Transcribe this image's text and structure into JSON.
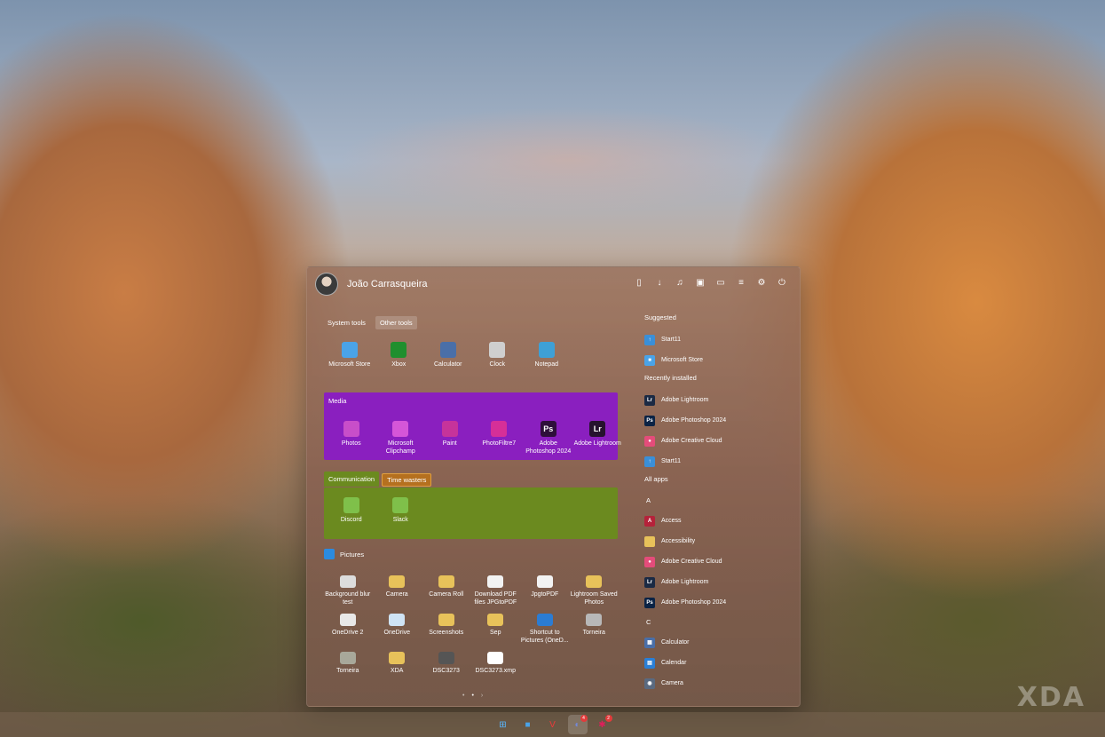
{
  "user": {
    "name": "João Carrasqueira"
  },
  "top_icons": [
    "document-icon",
    "download-icon",
    "music-icon",
    "image-icon",
    "folder-icon",
    "sliders-icon",
    "gear-icon",
    "power-icon"
  ],
  "tabs1": [
    {
      "label": "System tools",
      "active": false
    },
    {
      "label": "Other tools",
      "active": true
    }
  ],
  "system_apps": [
    {
      "label": "Microsoft Store",
      "icon": "store-icon",
      "color": "#4aa3e8"
    },
    {
      "label": "Xbox",
      "icon": "xbox-icon",
      "color": "#1f8f2e"
    },
    {
      "label": "Calculator",
      "icon": "calculator-icon",
      "color": "#4a6fa8"
    },
    {
      "label": "Clock",
      "icon": "clock-icon",
      "color": "#cfcfcf"
    },
    {
      "label": "Notepad",
      "icon": "notepad-icon",
      "color": "#3ea0d6"
    }
  ],
  "media": {
    "title": "Media",
    "color": "#8a1fbf",
    "apps": [
      {
        "label": "Photos",
        "icon": "photos-icon",
        "color": "#c84ec9"
      },
      {
        "label": "Microsoft Clipchamp",
        "icon": "clipchamp-icon",
        "color": "#d556d8"
      },
      {
        "label": "Paint",
        "icon": "paint-icon",
        "color": "#c6339b"
      },
      {
        "label": "PhotoFiltre7",
        "icon": "photofiltre-icon",
        "color": "#d62f98"
      },
      {
        "label": "Adobe Photoshop 2024",
        "icon": "photoshop-icon",
        "color": "#2f0f3a",
        "glyph": "Ps"
      },
      {
        "label": "Adobe Lightroom",
        "icon": "lightroom-icon",
        "color": "#26122e",
        "glyph": "Lr"
      }
    ]
  },
  "tabs2": [
    {
      "label": "Communication",
      "active": true
    },
    {
      "label": "Time wasters",
      "active": false
    }
  ],
  "communication": {
    "color": "#6b8a1f",
    "apps": [
      {
        "label": "Discord",
        "icon": "discord-icon",
        "color": "#7fc04a"
      },
      {
        "label": "Slack",
        "icon": "slack-icon",
        "color": "#7fc04a"
      }
    ]
  },
  "pictures": {
    "title": "Pictures",
    "items": [
      {
        "label": "Background blur test",
        "icon": "file-thumbnail-icon",
        "color": "#dcdcdc"
      },
      {
        "label": "Camera",
        "icon": "folder-icon",
        "color": "#e8c25a"
      },
      {
        "label": "Camera Roll",
        "icon": "folder-icon",
        "color": "#e8c25a"
      },
      {
        "label": "Download PDF files JPGtoPDF",
        "icon": "file-thumbnail-icon",
        "color": "#f2f2f2"
      },
      {
        "label": "JpgtoPDF",
        "icon": "file-thumbnail-icon",
        "color": "#f2f2f2"
      },
      {
        "label": "Lightroom Saved Photos",
        "icon": "folder-icon",
        "color": "#e8c25a"
      },
      {
        "label": "OneDrive 2",
        "icon": "file-thumbnail-icon",
        "color": "#e8e8e8"
      },
      {
        "label": "OneDrive",
        "icon": "file-thumbnail-icon",
        "color": "#cfe3f4"
      },
      {
        "label": "Screenshots",
        "icon": "folder-icon",
        "color": "#e8c25a"
      },
      {
        "label": "Sep",
        "icon": "folder-icon",
        "color": "#e8c25a"
      },
      {
        "label": "Shortcut to Pictures (OneD...",
        "icon": "onedrive-icon",
        "color": "#2b7cd3"
      },
      {
        "label": "Torneira",
        "icon": "file-thumbnail-icon",
        "color": "#b8b8b8"
      },
      {
        "label": "Torneira",
        "icon": "file-thumbnail-icon",
        "color": "#a8a89a"
      },
      {
        "label": "XDA",
        "icon": "folder-icon",
        "color": "#e8c25a"
      },
      {
        "label": "DSC3273",
        "icon": "file-thumbnail-icon",
        "color": "#555555"
      },
      {
        "label": "DSC3273.xmp",
        "icon": "file-icon",
        "color": "#ffffff"
      }
    ]
  },
  "pager": [
    "•",
    "•",
    "›"
  ],
  "suggested": {
    "title": "Suggested",
    "items": [
      {
        "label": "Start11",
        "icon": "start11-icon",
        "color": "#3a8fd8",
        "glyph": "↑"
      },
      {
        "label": "Microsoft Store",
        "icon": "store-icon",
        "color": "#4aa3e8",
        "glyph": "■"
      }
    ]
  },
  "recent": {
    "title": "Recently installed",
    "items": [
      {
        "label": "Adobe Lightroom",
        "icon": "lightroom-icon",
        "color": "#1b2a44",
        "glyph": "Lr"
      },
      {
        "label": "Adobe Photoshop 2024",
        "icon": "photoshop-icon",
        "color": "#0b2345",
        "glyph": "Ps"
      },
      {
        "label": "Adobe Creative Cloud",
        "icon": "creative-cloud-icon",
        "color": "#e44c7a",
        "glyph": "●"
      },
      {
        "label": "Start11",
        "icon": "start11-icon",
        "color": "#3a8fd8",
        "glyph": "↑"
      }
    ]
  },
  "all_apps": {
    "title": "All apps",
    "sections": [
      {
        "letter": "A",
        "items": [
          {
            "label": "Access",
            "icon": "access-icon",
            "color": "#b5223a",
            "glyph": "A"
          },
          {
            "label": "Accessibility",
            "icon": "folder-icon",
            "color": "#e8c25a",
            "glyph": ""
          },
          {
            "label": "Adobe Creative Cloud",
            "icon": "creative-cloud-icon",
            "color": "#e44c7a",
            "glyph": "●"
          },
          {
            "label": "Adobe Lightroom",
            "icon": "lightroom-icon",
            "color": "#1b2a44",
            "glyph": "Lr"
          },
          {
            "label": "Adobe Photoshop 2024",
            "icon": "photoshop-icon",
            "color": "#0b2345",
            "glyph": "Ps"
          }
        ]
      },
      {
        "letter": "C",
        "items": [
          {
            "label": "Calculator",
            "icon": "calculator-icon",
            "color": "#4a6fa8",
            "glyph": "▦"
          },
          {
            "label": "Calendar",
            "icon": "calendar-icon",
            "color": "#2a7fd6",
            "glyph": "▤"
          },
          {
            "label": "Camera",
            "icon": "camera-icon",
            "color": "#5a6a80",
            "glyph": "◉"
          }
        ]
      }
    ]
  },
  "taskbar": [
    {
      "name": "windows-start-icon",
      "glyph": "⊞",
      "color": "#58b7ff",
      "active": false,
      "badge": ""
    },
    {
      "name": "store-icon",
      "glyph": "■",
      "color": "#4aa3e8",
      "active": false,
      "badge": ""
    },
    {
      "name": "vivaldi-icon",
      "glyph": "V",
      "color": "#ef3939",
      "active": false,
      "badge": ""
    },
    {
      "name": "discord-icon",
      "glyph": "◐",
      "color": "#7289da",
      "active": true,
      "badge": "4"
    },
    {
      "name": "slack-icon",
      "glyph": "✱",
      "color": "#e01e5a",
      "active": false,
      "badge": "2"
    }
  ],
  "watermark": "XDA"
}
